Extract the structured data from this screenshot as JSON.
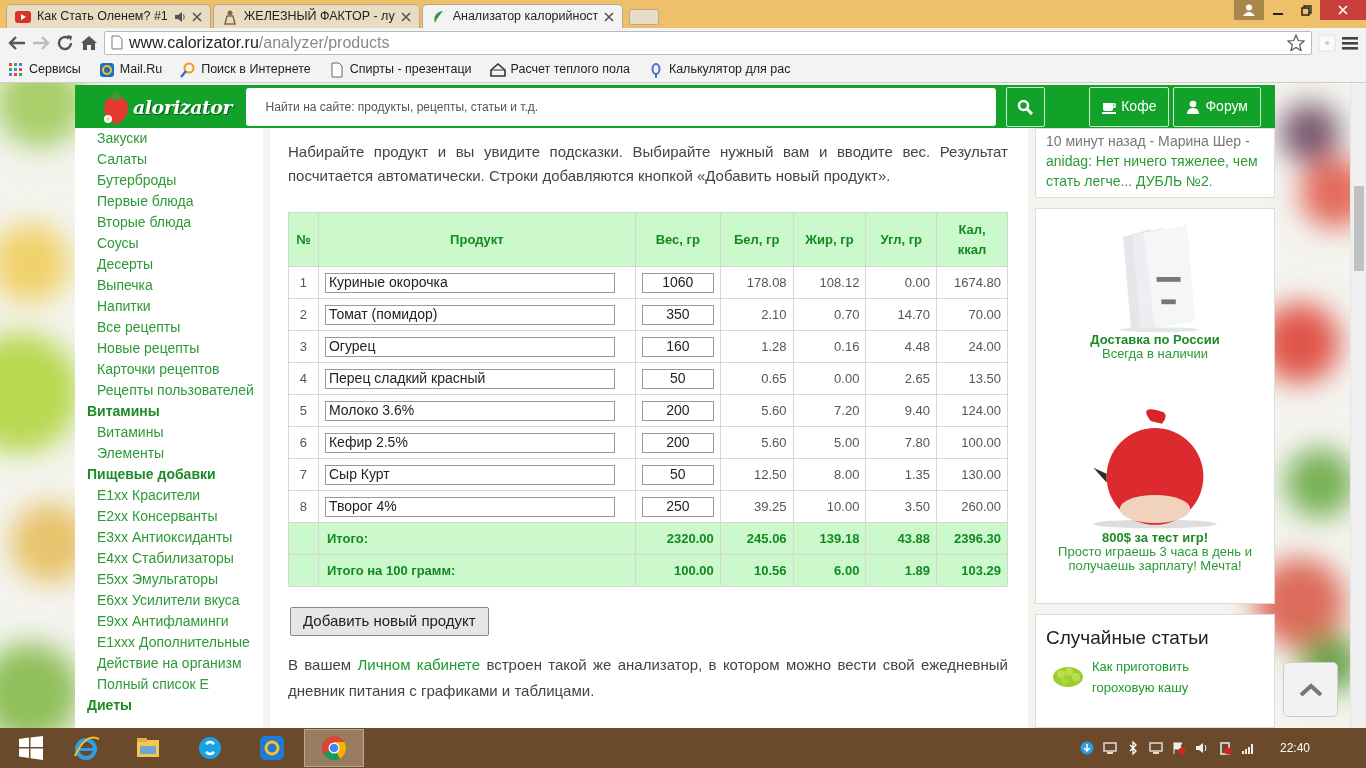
{
  "browser": {
    "tabs": [
      {
        "title": "Как Стать Оленем? #1",
        "selected": false,
        "playing_audio": true,
        "kind": "video"
      },
      {
        "title": "ЖЕЛЕЗНЫЙ ФАКТОР - лу",
        "selected": false,
        "playing_audio": false,
        "kind": "figure"
      },
      {
        "title": "Анализатор калорийност",
        "selected": true,
        "playing_audio": false,
        "kind": "leaf"
      }
    ],
    "address": {
      "host": "www.calorizator.ru",
      "path": "/analyzer/products"
    },
    "bookmarks": [
      {
        "label": "Сервисы",
        "kind": "apps"
      },
      {
        "label": "Mail.Ru",
        "kind": "mail"
      },
      {
        "label": "Поиск в Интернете",
        "kind": "search"
      },
      {
        "label": "Спирты - презентаци",
        "kind": "page"
      },
      {
        "label": "Расчет теплого пола",
        "kind": "house"
      },
      {
        "label": "Калькулятор для рас",
        "kind": "pin"
      }
    ]
  },
  "site_header": {
    "logo_text": "alorizator",
    "search_placeholder": "Найти на сайте: продукты, рецепты, статьи и т.д.",
    "buttons": [
      {
        "label": "Кофе",
        "kind": "coffee"
      },
      {
        "label": "Форум",
        "kind": "user"
      }
    ]
  },
  "sidebar": {
    "items": [
      {
        "label": "Закуски",
        "kind": "link"
      },
      {
        "label": "Салаты",
        "kind": "link"
      },
      {
        "label": "Бутерброды",
        "kind": "link"
      },
      {
        "label": "Первые блюда",
        "kind": "link"
      },
      {
        "label": "Вторые блюда",
        "kind": "link"
      },
      {
        "label": "Соусы",
        "kind": "link"
      },
      {
        "label": "Десерты",
        "kind": "link"
      },
      {
        "label": "Выпечка",
        "kind": "link"
      },
      {
        "label": "Напитки",
        "kind": "link"
      },
      {
        "label": "Все рецепты",
        "kind": "link"
      },
      {
        "label": "Новые рецепты",
        "kind": "link"
      },
      {
        "label": "Карточки рецептов",
        "kind": "link"
      },
      {
        "label": "Рецепты пользователей",
        "kind": "link"
      },
      {
        "label": "Витамины",
        "kind": "heading"
      },
      {
        "label": "Витамины",
        "kind": "link"
      },
      {
        "label": "Элементы",
        "kind": "link"
      },
      {
        "label": "Пищевые добавки",
        "kind": "heading"
      },
      {
        "label": "E1xx Красители",
        "kind": "link"
      },
      {
        "label": "E2xx Консерванты",
        "kind": "link"
      },
      {
        "label": "E3xx Антиоксиданты",
        "kind": "link"
      },
      {
        "label": "E4xx Стабилизаторы",
        "kind": "link"
      },
      {
        "label": "E5xx Эмульгаторы",
        "kind": "link"
      },
      {
        "label": "E6xx Усилители вкуса",
        "kind": "link"
      },
      {
        "label": "E9xx Антифламинги",
        "kind": "link"
      },
      {
        "label": "E1xxx Дополнительные",
        "kind": "link"
      },
      {
        "label": "Действие на организм",
        "kind": "link"
      },
      {
        "label": "Полный список E",
        "kind": "link"
      },
      {
        "label": "Диеты",
        "kind": "heading"
      }
    ]
  },
  "main": {
    "intro": "Набирайте продукт и вы увидите подсказки. Выбирайте нужный вам и вводите вес. Результат посчитается автоматически. Строки добавляются кнопкой «Добавить новый продукт».",
    "table": {
      "columns": [
        "№",
        "Продукт",
        "Вес, гр",
        "Бел, гр",
        "Жир, гр",
        "Угл, гр",
        "Кал, ккал"
      ],
      "rows": [
        {
          "n": "1",
          "product": "Куриные окорочка",
          "weight": "1060",
          "protein": "178.08",
          "fat": "108.12",
          "carbs": "0.00",
          "kcal": "1674.80"
        },
        {
          "n": "2",
          "product": "Томат (помидор)",
          "weight": "350",
          "protein": "2.10",
          "fat": "0.70",
          "carbs": "14.70",
          "kcal": "70.00"
        },
        {
          "n": "3",
          "product": "Огурец",
          "weight": "160",
          "protein": "1.28",
          "fat": "0.16",
          "carbs": "4.48",
          "kcal": "24.00"
        },
        {
          "n": "4",
          "product": "Перец сладкий красный",
          "weight": "50",
          "protein": "0.65",
          "fat": "0.00",
          "carbs": "2.65",
          "kcal": "13.50"
        },
        {
          "n": "5",
          "product": "Молоко 3.6%",
          "weight": "200",
          "protein": "5.60",
          "fat": "7.20",
          "carbs": "9.40",
          "kcal": "124.00"
        },
        {
          "n": "6",
          "product": "Кефир 2.5%",
          "weight": "200",
          "protein": "5.60",
          "fat": "5.00",
          "carbs": "7.80",
          "kcal": "100.00"
        },
        {
          "n": "7",
          "product": "Сыр Курт",
          "weight": "50",
          "protein": "12.50",
          "fat": "8.00",
          "carbs": "1.35",
          "kcal": "130.00"
        },
        {
          "n": "8",
          "product": "Творог 4%",
          "weight": "250",
          "protein": "39.25",
          "fat": "10.00",
          "carbs": "3.50",
          "kcal": "260.00"
        }
      ],
      "totals": [
        {
          "label": "Итого:",
          "weight": "2320.00",
          "protein": "245.06",
          "fat": "139.18",
          "carbs": "43.88",
          "kcal": "2396.30"
        },
        {
          "label": "Итого на 100 грамм:",
          "weight": "100.00",
          "protein": "10.56",
          "fat": "6.00",
          "carbs": "1.89",
          "kcal": "103.29"
        }
      ]
    },
    "add_button": "Добавить новый продукт",
    "outro": {
      "before": "В вашем ",
      "link": "Личном кабинете",
      "after": " встроен такой же анализатор, в котором можно вести свой ежедневный дневник питания с графиками и таблицами."
    }
  },
  "right_column": {
    "comment": {
      "meta": "10 минут назад - Марина Шер -",
      "text": "anidag: Нет ничего тяжелее, чем стать легче... ДУБЛЬ №2."
    },
    "ads": [
      {
        "title": "Доставка по России",
        "subtitle": "Всегда в наличии"
      },
      {
        "title": "800$ за тест игр!",
        "subtitle": "Просто играешь 3 часа в день и получаешь зарплату! Мечта!"
      }
    ],
    "random_articles": {
      "title": "Случайные статьи",
      "items": [
        {
          "label": "Как приготовить гороховую кашу"
        }
      ]
    }
  },
  "taskbar": {
    "apps": [
      {
        "kind": "ie",
        "selected": false
      },
      {
        "kind": "explorer",
        "selected": false
      },
      {
        "kind": "skype",
        "selected": false
      },
      {
        "kind": "mail",
        "selected": false
      },
      {
        "kind": "chrome",
        "selected": true
      }
    ],
    "clock": "22:40"
  }
}
